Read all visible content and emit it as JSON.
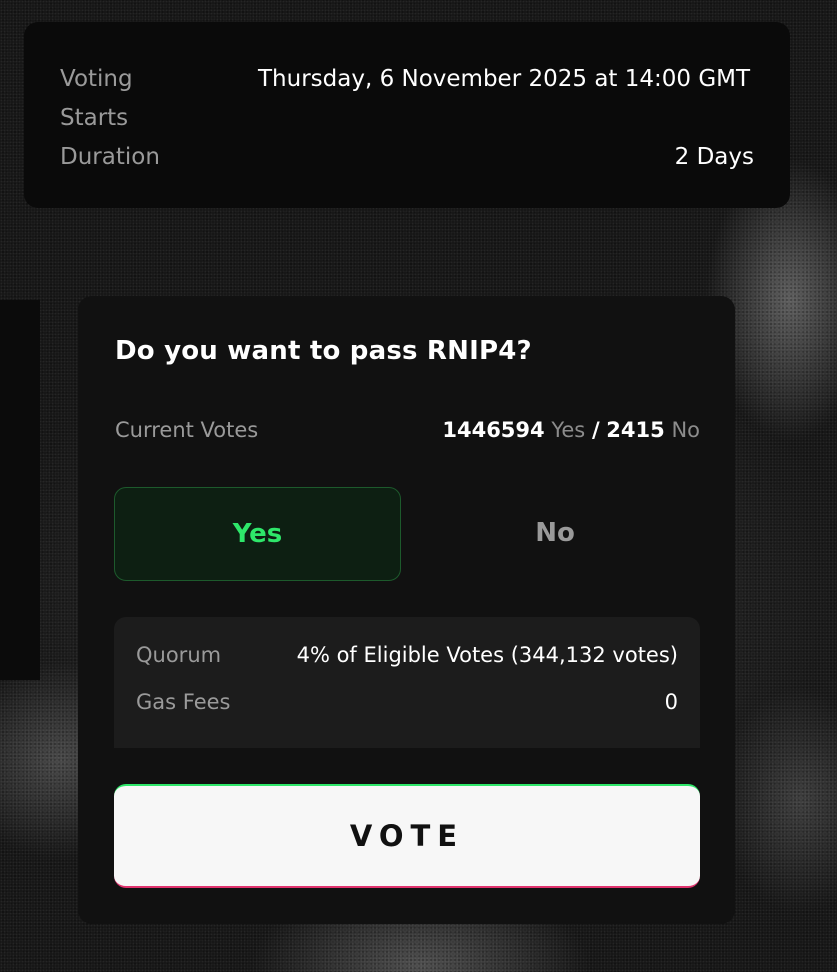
{
  "schedule": {
    "voting_starts_label": "Voting Starts",
    "voting_starts_value": "Thursday, 6 November 2025 at 14:00 GMT",
    "duration_label": "Duration",
    "duration_value": "2 Days"
  },
  "poll": {
    "question": "Do you want to pass RNIP4?",
    "current_votes_label": "Current Votes",
    "yes_count": "1446594",
    "yes_word": "Yes",
    "separator": "/",
    "no_count": "2415",
    "no_word": "No",
    "options": [
      {
        "label": "Yes",
        "selected": true,
        "color": "#2ee76a"
      },
      {
        "label": "No",
        "selected": false
      }
    ]
  },
  "details": {
    "quorum_label": "Quorum",
    "quorum_value": "4% of Eligible Votes (344,132 votes)",
    "gas_label": "Gas Fees",
    "gas_value": "0"
  },
  "actions": {
    "vote_label": "VOTE"
  },
  "colors": {
    "accent_green": "#2ee76a",
    "accent_pink": "#e0336e",
    "panel_bg": "#111111"
  }
}
